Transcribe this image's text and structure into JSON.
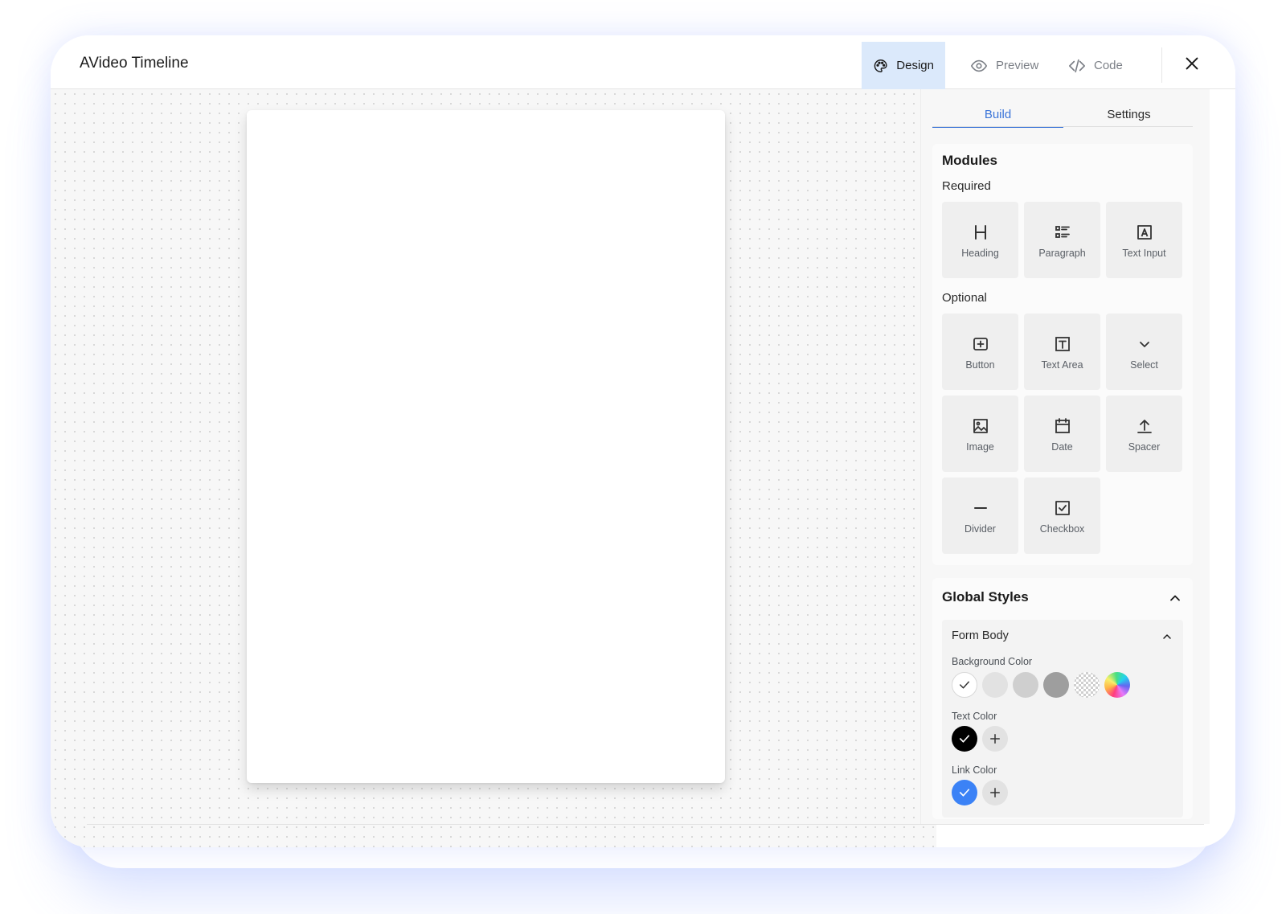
{
  "app": {
    "title": "AVideo Timeline"
  },
  "modes": {
    "design": "Design",
    "preview": "Preview",
    "code": "Code"
  },
  "panel": {
    "tabs": {
      "build": "Build",
      "settings": "Settings"
    },
    "modules": {
      "title": "Modules",
      "required_label": "Required",
      "optional_label": "Optional",
      "required": [
        {
          "label": "Heading",
          "icon": "heading-icon"
        },
        {
          "label": "Paragraph",
          "icon": "paragraph-icon"
        },
        {
          "label": "Text Input",
          "icon": "text-input-icon"
        }
      ],
      "optional": [
        {
          "label": "Button",
          "icon": "button-icon"
        },
        {
          "label": "Text Area",
          "icon": "text-area-icon"
        },
        {
          "label": "Select",
          "icon": "chevron-down-icon"
        },
        {
          "label": "Image",
          "icon": "image-icon"
        },
        {
          "label": "Date",
          "icon": "calendar-icon"
        },
        {
          "label": "Spacer",
          "icon": "upload-arrow-icon"
        },
        {
          "label": "Divider",
          "icon": "minus-icon"
        },
        {
          "label": "Checkbox",
          "icon": "checkbox-icon"
        }
      ]
    },
    "global_styles": {
      "title": "Global Styles",
      "form_body": {
        "title": "Form Body",
        "background_color_label": "Background Color",
        "text_color_label": "Text Color",
        "link_color_label": "Link Color",
        "background_swatches": [
          "#ffffff",
          "#e2e2e2",
          "#cfcfcf",
          "#9e9e9e",
          "transparent-pattern",
          "gradient"
        ],
        "text_color": "#000000",
        "link_color": "#3b82f6",
        "accent": "#3a74d8"
      }
    }
  }
}
